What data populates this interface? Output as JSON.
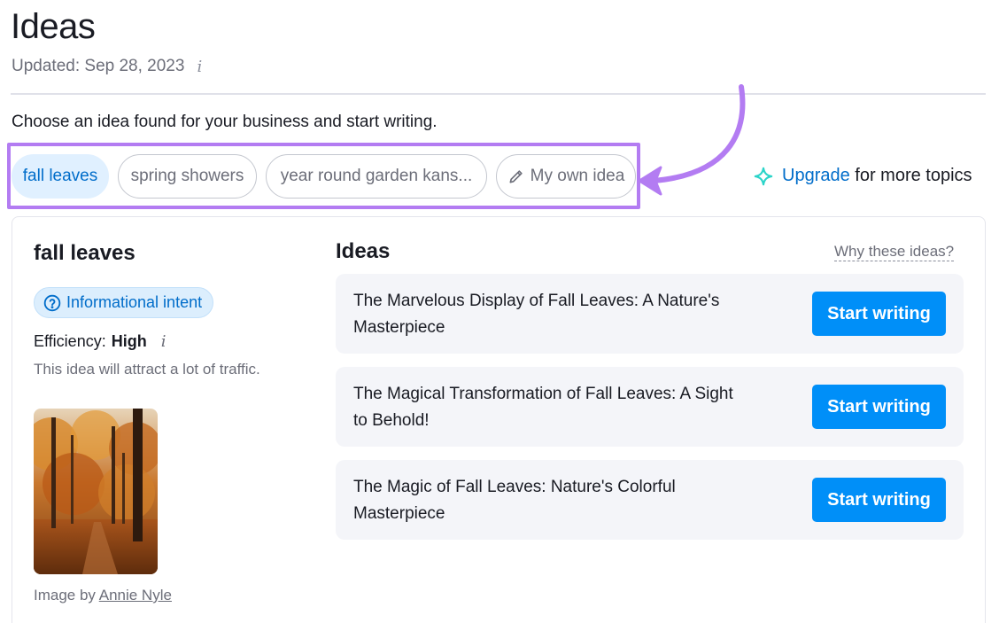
{
  "header": {
    "title": "Ideas",
    "updated": "Updated: Sep 28, 2023",
    "info_glyph": "i",
    "subtitle": "Choose an idea found for your business and start writing."
  },
  "topic_tabs": [
    {
      "label": "fall leaves",
      "active": true
    },
    {
      "label": "spring showers",
      "active": false
    },
    {
      "label": "year round garden kans...",
      "active": false
    },
    {
      "label": "My own idea",
      "active": false,
      "icon": "pencil-icon"
    }
  ],
  "upgrade": {
    "link": "Upgrade",
    "suffix": "for more topics",
    "icon": "sparkle-icon"
  },
  "topic": {
    "name": "fall leaves",
    "intent_label": "Informational intent",
    "intent_icon": "question-circle-icon",
    "efficiency_label": "Efficiency:",
    "efficiency_value": "High",
    "efficiency_desc": "This idea will attract a lot of traffic.",
    "image_credit_prefix": "Image by",
    "image_author": "Annie Nyle"
  },
  "ideas": {
    "title": "Ideas",
    "why_link": "Why these ideas?",
    "items": [
      {
        "text": "The Marvelous Display of Fall Leaves: A Nature's Masterpiece",
        "button": "Start writing"
      },
      {
        "text": "The Magical Transformation of Fall Leaves: A Sight to Behold!",
        "button": "Start writing"
      },
      {
        "text": "The Magic of Fall Leaves: Nature's Colorful Masterpiece",
        "button": "Start writing"
      }
    ]
  },
  "colors": {
    "accent_blue": "#008ff8",
    "link_blue": "#006dca",
    "highlight_purple": "#b37cf2",
    "upgrade_icon": "#2bd4c9"
  }
}
